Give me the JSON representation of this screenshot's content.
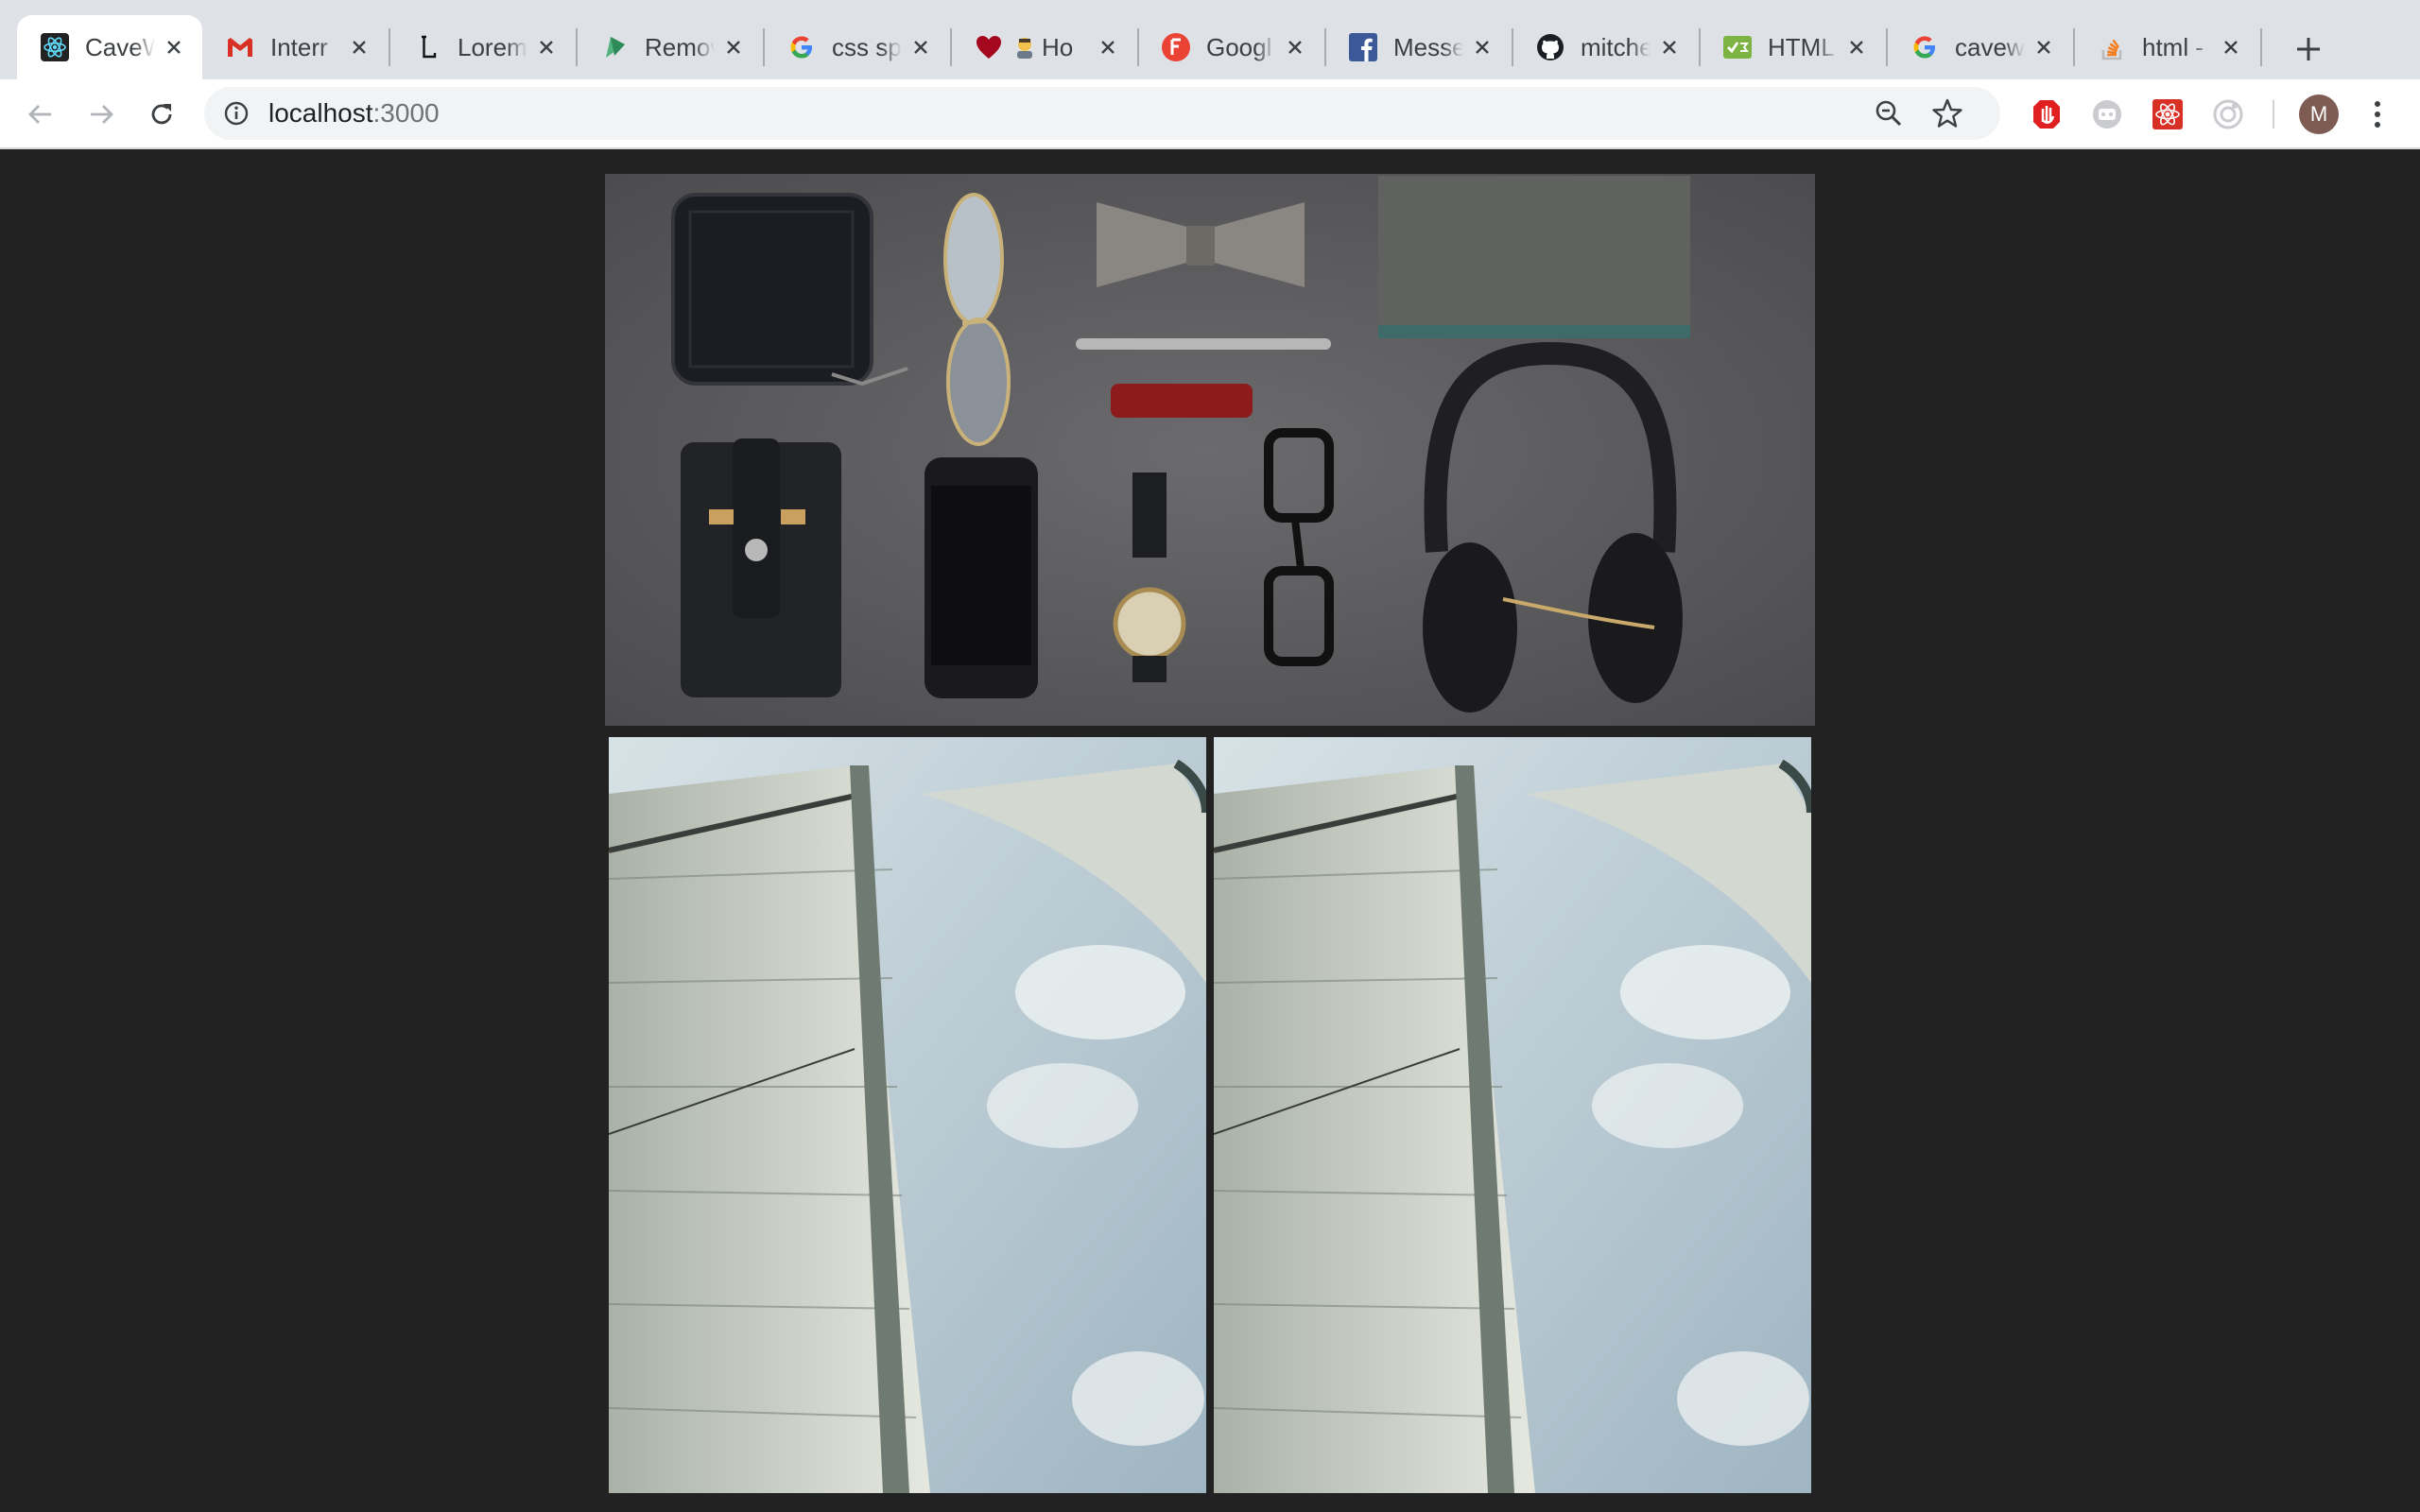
{
  "browser": {
    "tabs": [
      {
        "title": "CaveW",
        "icon": "react-icon",
        "active": true
      },
      {
        "title": "Interr",
        "icon": "gmail-icon",
        "active": false
      },
      {
        "title": "Lorem",
        "icon": "lorem-l-icon",
        "active": false
      },
      {
        "title": "Remov",
        "icon": "remove-bg-icon",
        "active": false
      },
      {
        "title": "css sp",
        "icon": "google-icon",
        "active": false
      },
      {
        "title": "Ho",
        "icon": "heart-icon",
        "active": false
      },
      {
        "title": "Googl",
        "icon": "font-f-icon",
        "active": false
      },
      {
        "title": "Messe",
        "icon": "facebook-icon",
        "active": false
      },
      {
        "title": "mitche",
        "icon": "github-icon",
        "active": false
      },
      {
        "title": "HTML",
        "icon": "html-validator-icon",
        "active": false
      },
      {
        "title": "cavew",
        "icon": "google-icon",
        "active": false
      },
      {
        "title": "html -",
        "icon": "stackoverflow-icon",
        "active": false
      }
    ],
    "address_bar": {
      "host": "localhost",
      "port": ":3000"
    },
    "profile_initial": "M",
    "colors": {
      "tabstrip": "#dee1e6",
      "toolbar": "#ffffff",
      "page_background": "#222222"
    }
  },
  "page": {
    "images": [
      {
        "name": "flat-lay-accessories-photo",
        "description": "wallet, aviator sunglasses, bow tie, pen, red lighter, notebook, phone pouch, phone, watch, eyeglasses, headphones on grey background"
      },
      {
        "name": "sail-photo-left",
        "description": "sailboat mast and sail against cloudy sky"
      },
      {
        "name": "sail-photo-right",
        "description": "sailboat mast and sail against cloudy sky"
      }
    ]
  }
}
